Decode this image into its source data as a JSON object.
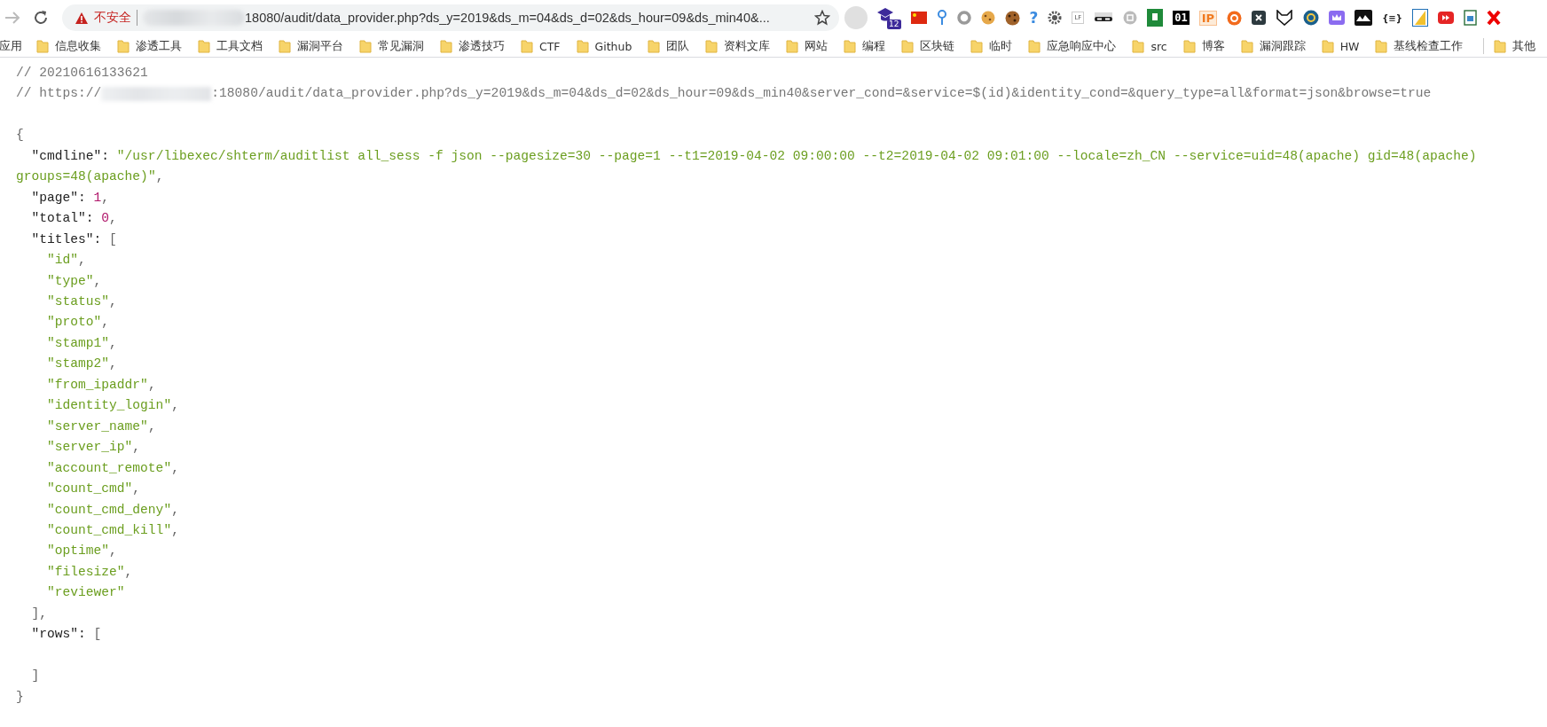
{
  "toolbar": {
    "security_label": "不安全",
    "url": "18080/audit/data_provider.php?ds_y=2019&ds_m=04&ds_d=02&ds_hour=09&ds_min40&...",
    "extensions": [
      {
        "kind": "cap",
        "text": "12"
      },
      {
        "kind": "flag"
      },
      {
        "kind": "pin"
      },
      {
        "kind": "ring"
      },
      {
        "kind": "cookie"
      },
      {
        "kind": "cookie-dark"
      },
      {
        "kind": "question",
        "text": "?"
      },
      {
        "kind": "gear"
      },
      {
        "kind": "lf",
        "text": "LF"
      },
      {
        "kind": "mask"
      },
      {
        "kind": "cmd"
      },
      {
        "kind": "green"
      },
      {
        "kind": "zero-one",
        "text": "01"
      },
      {
        "kind": "ip",
        "text": "IP"
      },
      {
        "kind": "orange"
      },
      {
        "kind": "x-dark"
      },
      {
        "kind": "wolf"
      },
      {
        "kind": "blue-circle"
      },
      {
        "kind": "crown"
      },
      {
        "kind": "mountains"
      },
      {
        "kind": "braces",
        "text": "{≡}"
      },
      {
        "kind": "split"
      },
      {
        "kind": "play"
      },
      {
        "kind": "doc"
      },
      {
        "kind": "red-x"
      }
    ]
  },
  "bookmarks": [
    {
      "label": "应用",
      "kind": "apps"
    },
    {
      "label": "信息收集",
      "kind": "folder"
    },
    {
      "label": "渗透工具",
      "kind": "folder"
    },
    {
      "label": "工具文档",
      "kind": "folder"
    },
    {
      "label": "漏洞平台",
      "kind": "folder"
    },
    {
      "label": "常见漏洞",
      "kind": "folder"
    },
    {
      "label": "渗透技巧",
      "kind": "folder"
    },
    {
      "label": "CTF",
      "kind": "folder"
    },
    {
      "label": "Github",
      "kind": "folder"
    },
    {
      "label": "团队",
      "kind": "folder"
    },
    {
      "label": "资料文库",
      "kind": "folder"
    },
    {
      "label": "网站",
      "kind": "folder"
    },
    {
      "label": "编程",
      "kind": "folder"
    },
    {
      "label": "区块链",
      "kind": "folder"
    },
    {
      "label": "临时",
      "kind": "folder"
    },
    {
      "label": "应急响应中心",
      "kind": "folder"
    },
    {
      "label": "src",
      "kind": "folder"
    },
    {
      "label": "博客",
      "kind": "folder"
    },
    {
      "label": "漏洞跟踪",
      "kind": "folder"
    },
    {
      "label": "HW",
      "kind": "folder"
    },
    {
      "label": "基线检查工作",
      "kind": "folder"
    },
    {
      "label": "其他",
      "kind": "other"
    }
  ],
  "comments": [
    {
      "text": "// 20210616133621"
    },
    {
      "prefix": "// https://",
      "suffix": ":18080/audit/data_provider.php?ds_y=2019&ds_m=04&ds_d=02&ds_hour=09&ds_min40&server_cond=&service=$(id)&identity_cond=&query_type=all&format=json&browse=true"
    }
  ],
  "document": {
    "open": "{",
    "close": "}",
    "members": [
      {
        "kind": "string",
        "key": "\"cmdline\":",
        "value": "\"/usr/libexec/shterm/auditlist all_sess -f json --pagesize=30 --page=1 --t1=2019-04-02 09:00:00 --t2=2019-04-02 09:01:00 --locale=zh_CN --service=uid=48(apache) gid=48(apache) groups=48(apache)\"",
        "trail": ","
      },
      {
        "kind": "number",
        "key": "\"page\":",
        "value": "1",
        "trail": ","
      },
      {
        "kind": "number",
        "key": "\"total\":",
        "value": "0",
        "trail": ","
      },
      {
        "kind": "array",
        "key": "\"titles\":",
        "open": "[",
        "close": "]",
        "trail": ",",
        "items": [
          {
            "text": "\"id\"",
            "trail": ","
          },
          {
            "text": "\"type\"",
            "trail": ","
          },
          {
            "text": "\"status\"",
            "trail": ","
          },
          {
            "text": "\"proto\"",
            "trail": ","
          },
          {
            "text": "\"stamp1\"",
            "trail": ","
          },
          {
            "text": "\"stamp2\"",
            "trail": ","
          },
          {
            "text": "\"from_ipaddr\"",
            "trail": ","
          },
          {
            "text": "\"identity_login\"",
            "trail": ","
          },
          {
            "text": "\"server_name\"",
            "trail": ","
          },
          {
            "text": "\"server_ip\"",
            "trail": ","
          },
          {
            "text": "\"account_remote\"",
            "trail": ","
          },
          {
            "text": "\"count_cmd\"",
            "trail": ","
          },
          {
            "text": "\"count_cmd_deny\"",
            "trail": ","
          },
          {
            "text": "\"count_cmd_kill\"",
            "trail": ","
          },
          {
            "text": "\"optime\"",
            "trail": ","
          },
          {
            "text": "\"filesize\"",
            "trail": ","
          },
          {
            "text": "\"reviewer\""
          }
        ]
      },
      {
        "kind": "array",
        "key": "\"rows\":",
        "open": "[",
        "close": "]"
      }
    ]
  }
}
